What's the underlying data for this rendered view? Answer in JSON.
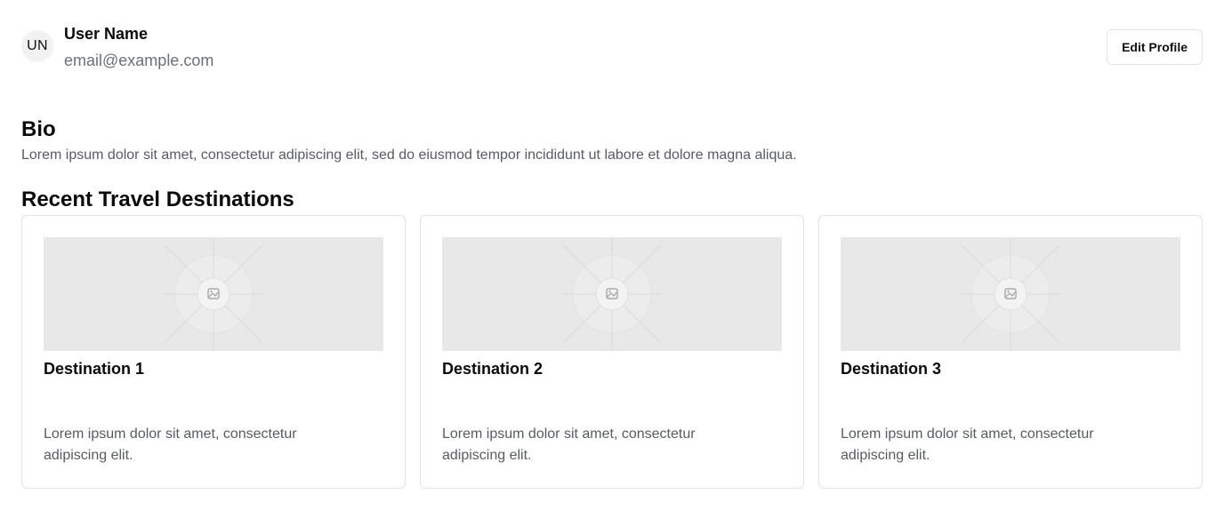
{
  "profile": {
    "avatar_initials": "UN",
    "name": "User Name",
    "email": "email@example.com",
    "edit_button_label": "Edit Profile"
  },
  "bio": {
    "title": "Bio",
    "text": "Lorem ipsum dolor sit amet, consectetur adipiscing elit, sed do eiusmod tempor incididunt ut labore et dolore magna aliqua."
  },
  "destinations": {
    "title": "Recent Travel Destinations",
    "cards": [
      {
        "title": "Destination 1",
        "description": "Lorem ipsum dolor sit amet, consectetur adipiscing elit.",
        "image_icon": "image-placeholder-icon"
      },
      {
        "title": "Destination 2",
        "description": "Lorem ipsum dolor sit amet, consectetur adipiscing elit.",
        "image_icon": "image-placeholder-icon"
      },
      {
        "title": "Destination 3",
        "description": "Lorem ipsum dolor sit amet, consectetur adipiscing elit.",
        "image_icon": "image-placeholder-icon"
      }
    ]
  },
  "colors": {
    "text_primary": "#0b0b0b",
    "text_muted": "#565b66",
    "border": "#e3e4e7",
    "placeholder_bg": "#e8e8e8"
  }
}
